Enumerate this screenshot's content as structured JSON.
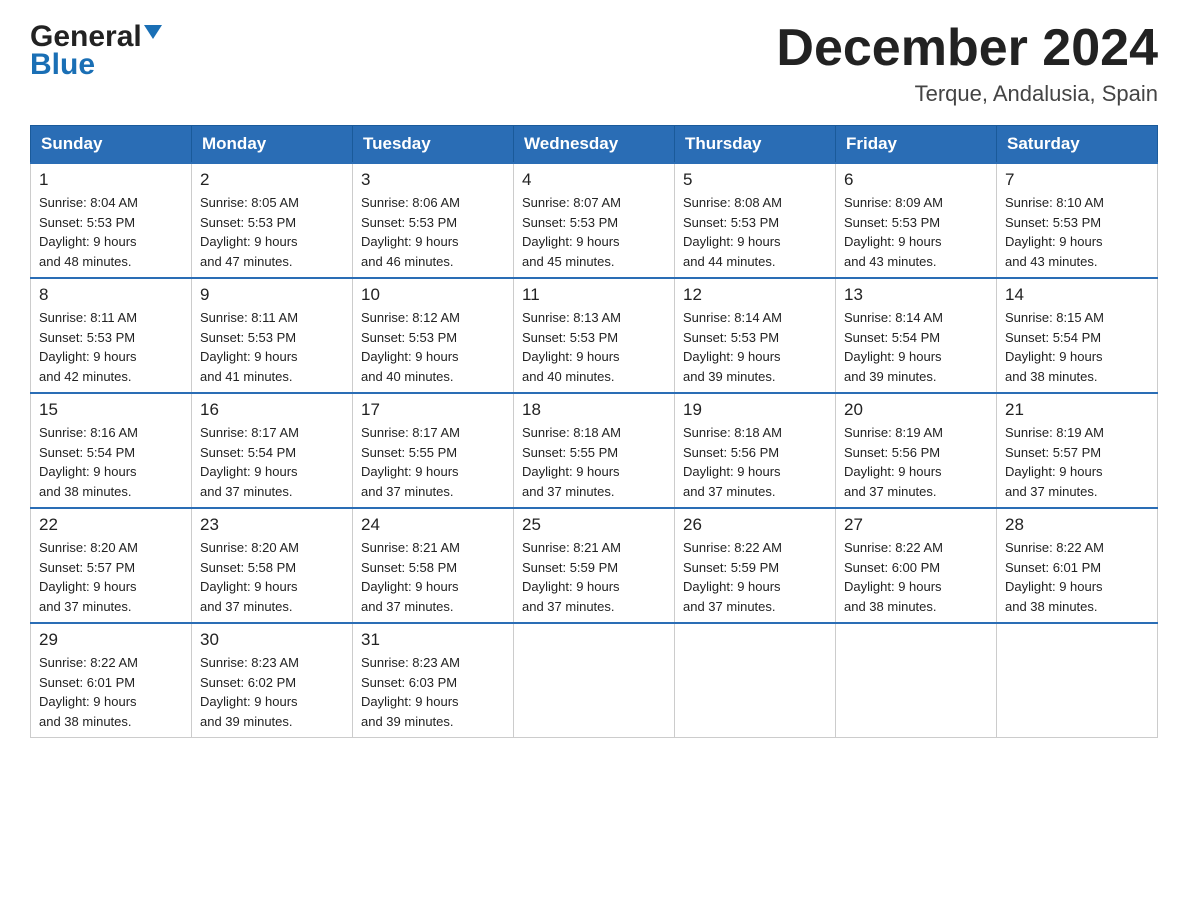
{
  "header": {
    "logo": {
      "general": "General",
      "blue": "Blue"
    },
    "title": "December 2024",
    "location": "Terque, Andalusia, Spain"
  },
  "days_of_week": [
    "Sunday",
    "Monday",
    "Tuesday",
    "Wednesday",
    "Thursday",
    "Friday",
    "Saturday"
  ],
  "weeks": [
    [
      {
        "day": "1",
        "sunrise": "8:04 AM",
        "sunset": "5:53 PM",
        "daylight": "9 hours and 48 minutes."
      },
      {
        "day": "2",
        "sunrise": "8:05 AM",
        "sunset": "5:53 PM",
        "daylight": "9 hours and 47 minutes."
      },
      {
        "day": "3",
        "sunrise": "8:06 AM",
        "sunset": "5:53 PM",
        "daylight": "9 hours and 46 minutes."
      },
      {
        "day": "4",
        "sunrise": "8:07 AM",
        "sunset": "5:53 PM",
        "daylight": "9 hours and 45 minutes."
      },
      {
        "day": "5",
        "sunrise": "8:08 AM",
        "sunset": "5:53 PM",
        "daylight": "9 hours and 44 minutes."
      },
      {
        "day": "6",
        "sunrise": "8:09 AM",
        "sunset": "5:53 PM",
        "daylight": "9 hours and 43 minutes."
      },
      {
        "day": "7",
        "sunrise": "8:10 AM",
        "sunset": "5:53 PM",
        "daylight": "9 hours and 43 minutes."
      }
    ],
    [
      {
        "day": "8",
        "sunrise": "8:11 AM",
        "sunset": "5:53 PM",
        "daylight": "9 hours and 42 minutes."
      },
      {
        "day": "9",
        "sunrise": "8:11 AM",
        "sunset": "5:53 PM",
        "daylight": "9 hours and 41 minutes."
      },
      {
        "day": "10",
        "sunrise": "8:12 AM",
        "sunset": "5:53 PM",
        "daylight": "9 hours and 40 minutes."
      },
      {
        "day": "11",
        "sunrise": "8:13 AM",
        "sunset": "5:53 PM",
        "daylight": "9 hours and 40 minutes."
      },
      {
        "day": "12",
        "sunrise": "8:14 AM",
        "sunset": "5:53 PM",
        "daylight": "9 hours and 39 minutes."
      },
      {
        "day": "13",
        "sunrise": "8:14 AM",
        "sunset": "5:54 PM",
        "daylight": "9 hours and 39 minutes."
      },
      {
        "day": "14",
        "sunrise": "8:15 AM",
        "sunset": "5:54 PM",
        "daylight": "9 hours and 38 minutes."
      }
    ],
    [
      {
        "day": "15",
        "sunrise": "8:16 AM",
        "sunset": "5:54 PM",
        "daylight": "9 hours and 38 minutes."
      },
      {
        "day": "16",
        "sunrise": "8:17 AM",
        "sunset": "5:54 PM",
        "daylight": "9 hours and 37 minutes."
      },
      {
        "day": "17",
        "sunrise": "8:17 AM",
        "sunset": "5:55 PM",
        "daylight": "9 hours and 37 minutes."
      },
      {
        "day": "18",
        "sunrise": "8:18 AM",
        "sunset": "5:55 PM",
        "daylight": "9 hours and 37 minutes."
      },
      {
        "day": "19",
        "sunrise": "8:18 AM",
        "sunset": "5:56 PM",
        "daylight": "9 hours and 37 minutes."
      },
      {
        "day": "20",
        "sunrise": "8:19 AM",
        "sunset": "5:56 PM",
        "daylight": "9 hours and 37 minutes."
      },
      {
        "day": "21",
        "sunrise": "8:19 AM",
        "sunset": "5:57 PM",
        "daylight": "9 hours and 37 minutes."
      }
    ],
    [
      {
        "day": "22",
        "sunrise": "8:20 AM",
        "sunset": "5:57 PM",
        "daylight": "9 hours and 37 minutes."
      },
      {
        "day": "23",
        "sunrise": "8:20 AM",
        "sunset": "5:58 PM",
        "daylight": "9 hours and 37 minutes."
      },
      {
        "day": "24",
        "sunrise": "8:21 AM",
        "sunset": "5:58 PM",
        "daylight": "9 hours and 37 minutes."
      },
      {
        "day": "25",
        "sunrise": "8:21 AM",
        "sunset": "5:59 PM",
        "daylight": "9 hours and 37 minutes."
      },
      {
        "day": "26",
        "sunrise": "8:22 AM",
        "sunset": "5:59 PM",
        "daylight": "9 hours and 37 minutes."
      },
      {
        "day": "27",
        "sunrise": "8:22 AM",
        "sunset": "6:00 PM",
        "daylight": "9 hours and 38 minutes."
      },
      {
        "day": "28",
        "sunrise": "8:22 AM",
        "sunset": "6:01 PM",
        "daylight": "9 hours and 38 minutes."
      }
    ],
    [
      {
        "day": "29",
        "sunrise": "8:22 AM",
        "sunset": "6:01 PM",
        "daylight": "9 hours and 38 minutes."
      },
      {
        "day": "30",
        "sunrise": "8:23 AM",
        "sunset": "6:02 PM",
        "daylight": "9 hours and 39 minutes."
      },
      {
        "day": "31",
        "sunrise": "8:23 AM",
        "sunset": "6:03 PM",
        "daylight": "9 hours and 39 minutes."
      },
      null,
      null,
      null,
      null
    ]
  ],
  "labels": {
    "sunrise": "Sunrise:",
    "sunset": "Sunset:",
    "daylight": "Daylight:"
  }
}
